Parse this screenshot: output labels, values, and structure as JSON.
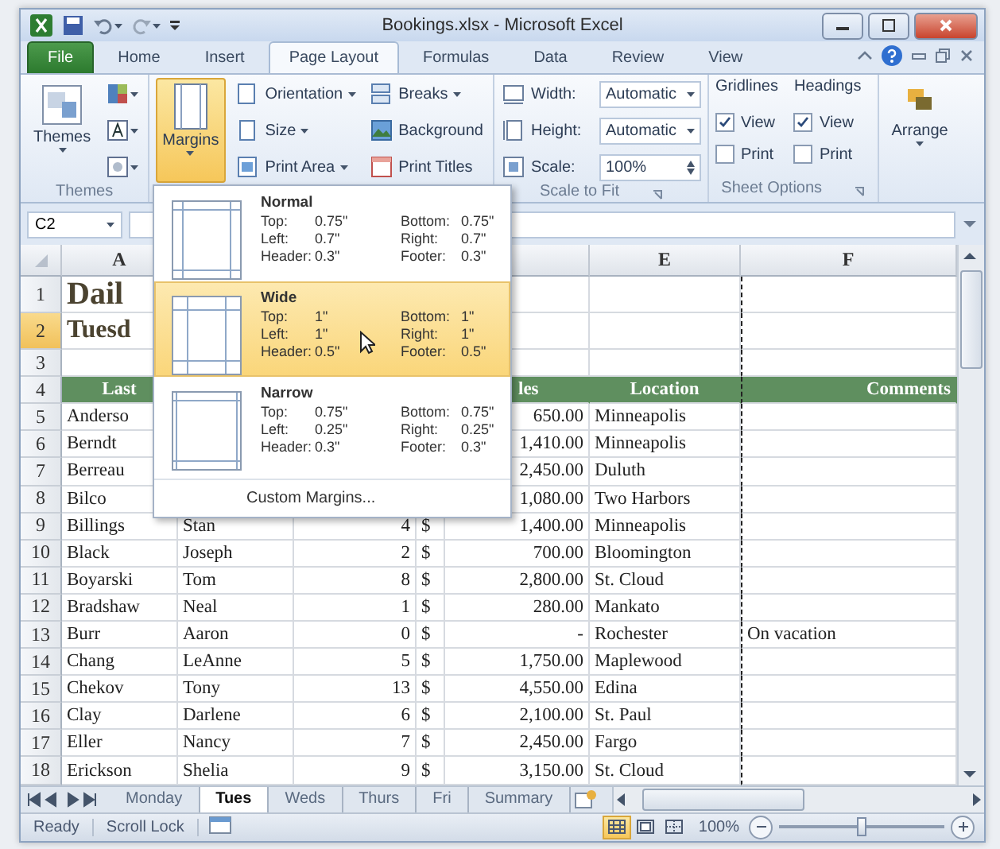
{
  "title_bar": {
    "title": "Bookings.xlsx - Microsoft Excel"
  },
  "ribbon_tabs": [
    {
      "label": "File",
      "kind": "file",
      "selected": false
    },
    {
      "label": "Home",
      "kind": "tab",
      "selected": false
    },
    {
      "label": "Insert",
      "kind": "tab",
      "selected": false
    },
    {
      "label": "Page Layout",
      "kind": "tab",
      "selected": true
    },
    {
      "label": "Formulas",
      "kind": "tab",
      "selected": false
    },
    {
      "label": "Data",
      "kind": "tab",
      "selected": false
    },
    {
      "label": "Review",
      "kind": "tab",
      "selected": false
    },
    {
      "label": "View",
      "kind": "tab",
      "selected": false
    }
  ],
  "ribbon": {
    "themes": {
      "button": "Themes",
      "label": "Themes"
    },
    "margins_button": {
      "label": "Margins",
      "pressed": true
    },
    "page_setup_items": [
      {
        "label": "Orientation",
        "dropdown": true
      },
      {
        "label": "Size",
        "dropdown": true
      },
      {
        "label": "Print Area",
        "dropdown": true
      },
      {
        "label": "Breaks",
        "dropdown": true
      },
      {
        "label": "Background",
        "dropdown": false
      },
      {
        "label": "Print Titles",
        "dropdown": false
      }
    ],
    "scale_to_fit": {
      "label": "Scale to Fit",
      "width": {
        "label": "Width:",
        "value": "Automatic"
      },
      "height": {
        "label": "Height:",
        "value": "Automatic"
      },
      "scale": {
        "label": "Scale:",
        "value": "100%"
      }
    },
    "sheet_options": {
      "label": "Sheet Options",
      "groups": [
        {
          "heading": "Gridlines",
          "view": {
            "label": "View",
            "checked": true
          },
          "print": {
            "label": "Print",
            "checked": false
          }
        },
        {
          "heading": "Headings",
          "view": {
            "label": "View",
            "checked": true
          },
          "print": {
            "label": "Print",
            "checked": false
          }
        }
      ]
    },
    "arrange": {
      "label": "Arrange"
    }
  },
  "formula_bar": {
    "name_box": "C2"
  },
  "column_headers": {
    "a": "A",
    "e": "E",
    "f": "F"
  },
  "rows": [
    {
      "number": "1",
      "kind": "title",
      "selected": false,
      "cells": {
        "a": "Dail"
      }
    },
    {
      "number": "2",
      "kind": "subtitle",
      "selected": true,
      "cells": {
        "a": "Tuesd"
      }
    },
    {
      "number": "3",
      "kind": "blank",
      "selected": false,
      "cells": {}
    },
    {
      "number": "4",
      "kind": "header",
      "selected": false,
      "cells": {
        "a": "Last",
        "d": "les",
        "e": "Location",
        "f": "Comments"
      }
    },
    {
      "number": "5",
      "kind": "data",
      "selected": false,
      "cells": {
        "a": "Anderso",
        "d_amount": "650.00",
        "e": "Minneapolis"
      }
    },
    {
      "number": "6",
      "kind": "data",
      "selected": false,
      "cells": {
        "a": "Berndt",
        "d_amount": "1,410.00",
        "e": "Minneapolis"
      }
    },
    {
      "number": "7",
      "kind": "data",
      "selected": false,
      "cells": {
        "a": "Berreau",
        "d_amount": "2,450.00",
        "e": "Duluth"
      }
    },
    {
      "number": "8",
      "kind": "data",
      "selected": false,
      "cells": {
        "a": "Bilco",
        "d_amount": "1,080.00",
        "e": "Two Harbors"
      }
    },
    {
      "number": "9",
      "kind": "data",
      "selected": false,
      "cells": {
        "a": "Billings",
        "b": "Stan",
        "c": "4",
        "d_sign": "$",
        "d_amount": "1,400.00",
        "e": "Minneapolis"
      }
    },
    {
      "number": "10",
      "kind": "data",
      "selected": false,
      "cells": {
        "a": "Black",
        "b": "Joseph",
        "c": "2",
        "d_sign": "$",
        "d_amount": "700.00",
        "e": "Bloomington"
      }
    },
    {
      "number": "11",
      "kind": "data",
      "selected": false,
      "cells": {
        "a": "Boyarski",
        "b": "Tom",
        "c": "8",
        "d_sign": "$",
        "d_amount": "2,800.00",
        "e": "St. Cloud"
      }
    },
    {
      "number": "12",
      "kind": "data",
      "selected": false,
      "cells": {
        "a": "Bradshaw",
        "b": "Neal",
        "c": "1",
        "d_sign": "$",
        "d_amount": "280.00",
        "e": "Mankato"
      }
    },
    {
      "number": "13",
      "kind": "data",
      "selected": false,
      "cells": {
        "a": "Burr",
        "b": "Aaron",
        "c": "0",
        "d_sign": "$",
        "d_amount": "-",
        "e": "Rochester",
        "f": "On vacation"
      }
    },
    {
      "number": "14",
      "kind": "data",
      "selected": false,
      "cells": {
        "a": "Chang",
        "b": "LeAnne",
        "c": "5",
        "d_sign": "$",
        "d_amount": "1,750.00",
        "e": "Maplewood"
      }
    },
    {
      "number": "15",
      "kind": "data",
      "selected": false,
      "cells": {
        "a": "Chekov",
        "b": "Tony",
        "c": "13",
        "d_sign": "$",
        "d_amount": "4,550.00",
        "e": "Edina"
      }
    },
    {
      "number": "16",
      "kind": "data",
      "selected": false,
      "cells": {
        "a": "Clay",
        "b": "Darlene",
        "c": "6",
        "d_sign": "$",
        "d_amount": "2,100.00",
        "e": "St. Paul"
      }
    },
    {
      "number": "17",
      "kind": "data",
      "selected": false,
      "cells": {
        "a": "Eller",
        "b": "Nancy",
        "c": "7",
        "d_sign": "$",
        "d_amount": "2,450.00",
        "e": "Fargo"
      }
    },
    {
      "number": "18",
      "kind": "data",
      "selected": false,
      "cells": {
        "a": "Erickson",
        "b": "Shelia",
        "c": "9",
        "d_sign": "$",
        "d_amount": "3,150.00",
        "e": "St. Cloud"
      }
    }
  ],
  "margins_menu": {
    "options": [
      {
        "name": "Normal",
        "kind": "normal",
        "selected": false,
        "lines": [
          {
            "left_label": "Top:",
            "left_value": "0.75\"",
            "right_label": "Bottom:",
            "right_value": "0.75\""
          },
          {
            "left_label": "Left:",
            "left_value": "0.7\"",
            "right_label": "Right:",
            "right_value": "0.7\""
          },
          {
            "left_label": "Header:",
            "left_value": "0.3\"",
            "right_label": "Footer:",
            "right_value": "0.3\""
          }
        ]
      },
      {
        "name": "Wide",
        "kind": "wide",
        "selected": true,
        "lines": [
          {
            "left_label": "Top:",
            "left_value": "1\"",
            "right_label": "Bottom:",
            "right_value": "1\""
          },
          {
            "left_label": "Left:",
            "left_value": "1\"",
            "right_label": "Right:",
            "right_value": "1\""
          },
          {
            "left_label": "Header:",
            "left_value": "0.5\"",
            "right_label": "Footer:",
            "right_value": "0.5\""
          }
        ]
      },
      {
        "name": "Narrow",
        "kind": "narrow",
        "selected": false,
        "lines": [
          {
            "left_label": "Top:",
            "left_value": "0.75\"",
            "right_label": "Bottom:",
            "right_value": "0.75\""
          },
          {
            "left_label": "Left:",
            "left_value": "0.25\"",
            "right_label": "Right:",
            "right_value": "0.25\""
          },
          {
            "left_label": "Header:",
            "left_value": "0.3\"",
            "right_label": "Footer:",
            "right_value": "0.3\""
          }
        ]
      }
    ],
    "custom": "Custom Margins..."
  },
  "sheet_tabs": [
    {
      "label": "Monday",
      "selected": false
    },
    {
      "label": "Tues",
      "selected": true
    },
    {
      "label": "Weds",
      "selected": false
    },
    {
      "label": "Thurs",
      "selected": false
    },
    {
      "label": "Fri",
      "selected": false
    },
    {
      "label": "Summary",
      "selected": false
    }
  ],
  "status_bar": {
    "items": [
      "Ready",
      "Scroll Lock"
    ],
    "views": [
      {
        "kind": "normal",
        "selected": true
      },
      {
        "kind": "page_layout",
        "selected": false
      },
      {
        "kind": "page_break",
        "selected": false
      }
    ],
    "zoom": "100%",
    "zoom_slider": {
      "level": 0.5
    }
  }
}
